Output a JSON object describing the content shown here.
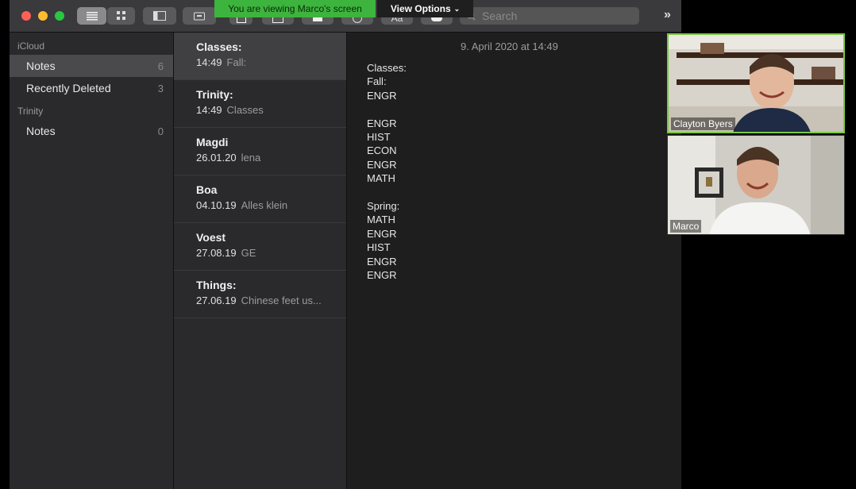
{
  "zoom": {
    "banner_text": "You are viewing Marco's screen",
    "view_options_label": "View Options",
    "banner_color": "#3db43d",
    "participants": [
      {
        "name": "Clayton Byers"
      },
      {
        "name": "Marco"
      }
    ]
  },
  "toolbar": {
    "search_placeholder": "Search",
    "more_label": "»",
    "font_button_label": "Aa"
  },
  "sidebar": {
    "sections": [
      {
        "title": "iCloud",
        "items": [
          {
            "label": "Notes",
            "count": "6"
          },
          {
            "label": "Recently Deleted",
            "count": "3"
          }
        ]
      },
      {
        "title": "Trinity",
        "items": [
          {
            "label": "Notes",
            "count": "0"
          }
        ]
      }
    ]
  },
  "notes": [
    {
      "title": "Classes:",
      "date": "14:49",
      "preview": "Fall:"
    },
    {
      "title": "Trinity:",
      "date": "14:49",
      "preview": "Classes"
    },
    {
      "title": "Magdi",
      "date": "26.01.20",
      "preview": "lena"
    },
    {
      "title": "Boa",
      "date": "04.10.19",
      "preview": "Alles klein"
    },
    {
      "title": "Voest",
      "date": "27.08.19",
      "preview": "GE"
    },
    {
      "title": "Things:",
      "date": "27.06.19",
      "preview": "Chinese feet us..."
    }
  ],
  "editor": {
    "date": "9. April 2020 at 14:49",
    "lines": [
      "Classes:",
      "Fall:",
      "ENGR",
      "",
      "ENGR",
      "HIST",
      "ECON",
      "ENGR",
      "MATH",
      "",
      "Spring:",
      "MATH",
      "ENGR",
      "HIST",
      "ENGR",
      "ENGR"
    ]
  }
}
